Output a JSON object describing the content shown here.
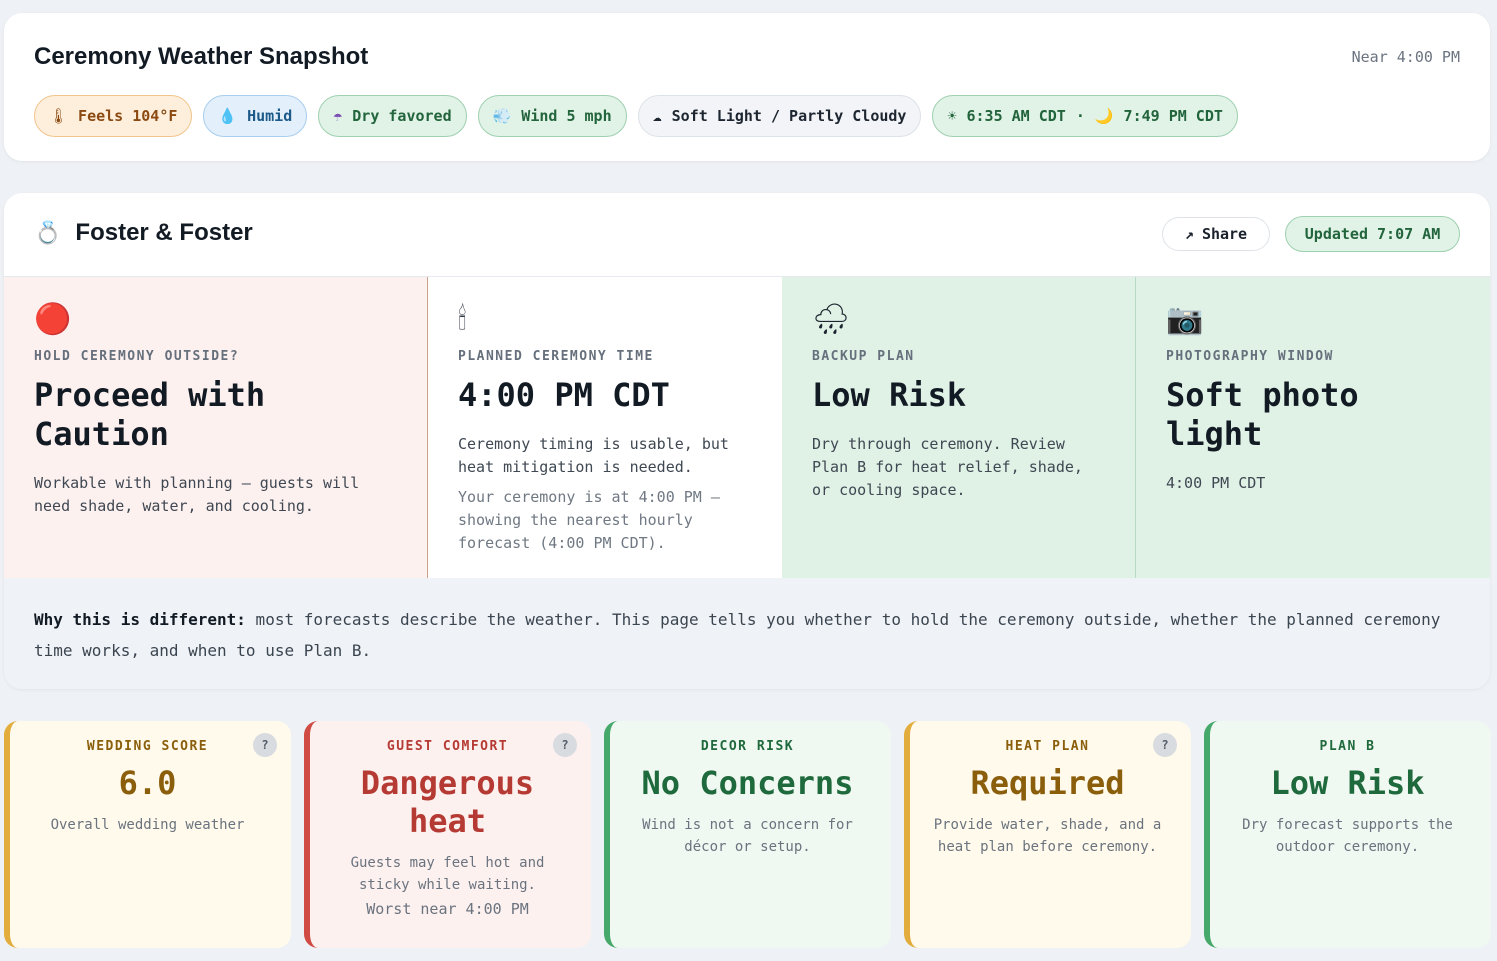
{
  "snapshot": {
    "title": "Ceremony Weather Snapshot",
    "near": "Near 4:00 PM",
    "chips": [
      {
        "icon": "🌡",
        "icon_name": "thermometer-icon",
        "label": "Feels 104°F"
      },
      {
        "icon": "💧",
        "icon_name": "droplet-icon",
        "label": "Humid"
      },
      {
        "icon": "☂",
        "icon_name": "umbrella-icon",
        "label": "Dry favored"
      },
      {
        "icon": "💨",
        "icon_name": "wind-icon",
        "label": "Wind 5 mph"
      },
      {
        "icon": "☁",
        "icon_name": "cloud-icon",
        "label": "Soft Light / Partly Cloudy"
      },
      {
        "icon": "☀",
        "icon_name": "sunrise-icon",
        "sunrise": "6:35 AM CDT",
        "sep": "·",
        "icon2": "🌙",
        "icon2_name": "moon-icon",
        "sunset": "7:49 PM CDT"
      }
    ]
  },
  "main": {
    "couple_icon": "💍",
    "couple": "Foster & Foster",
    "share_icon": "↗",
    "share_label": "Share",
    "updated": "Updated 7:07 AM",
    "panels": [
      {
        "icon": "🔴",
        "label": "HOLD CEREMONY OUTSIDE?",
        "value": "Proceed with Caution",
        "desc": "Workable with planning — guests will need shade, water, and cooling."
      },
      {
        "icon": "🕯",
        "label": "PLANNED CEREMONY TIME",
        "value": "4:00 PM CDT",
        "desc": "Ceremony timing is usable, but heat mitigation is needed.",
        "desc2": "Your ceremony is at 4:00 PM — showing the nearest hourly forecast (4:00 PM CDT)."
      },
      {
        "icon": "🌧",
        "label": "BACKUP PLAN",
        "value": "Low Risk",
        "desc": "Dry through ceremony. Review Plan B for heat relief, shade, or cooling space."
      },
      {
        "icon": "📷",
        "label": "PHOTOGRAPHY WINDOW",
        "value": "Soft photo light",
        "desc": "4:00 PM CDT"
      }
    ],
    "why_bold": "Why this is different:",
    "why_text": " most forecasts describe the weather. This page tells you whether to hold the ceremony outside, whether the planned ceremony time works, and when to use Plan B."
  },
  "scores": [
    {
      "label": "WEDDING SCORE",
      "value": "6.0",
      "desc": "Overall wedding weather",
      "help": "?"
    },
    {
      "label": "GUEST COMFORT",
      "value": "Dangerous heat",
      "desc": "Guests may feel hot and sticky while waiting.",
      "desc2": "Worst near 4:00 PM",
      "help": "?"
    },
    {
      "label": "DECOR RISK",
      "value": "No Concerns",
      "desc": "Wind is not a concern for décor or setup."
    },
    {
      "label": "HEAT PLAN",
      "value": "Required",
      "desc": "Provide water, shade, and a heat plan before ceremony.",
      "help": "?"
    },
    {
      "label": "PLAN B",
      "value": "Low Risk",
      "desc": "Dry forecast supports the outdoor ceremony."
    }
  ],
  "colors": {
    "risk_yellow": "#e2ad3c",
    "risk_red": "#cf4b44",
    "risk_green": "#46a96b"
  }
}
